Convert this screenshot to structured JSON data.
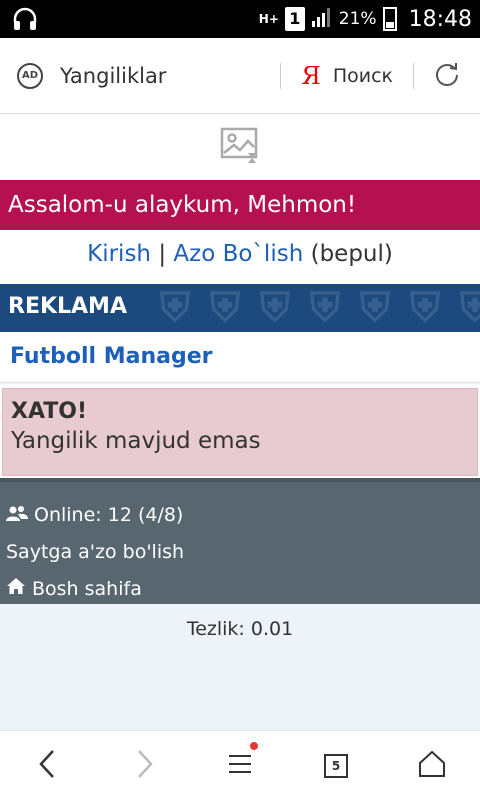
{
  "status_bar": {
    "network": "H+",
    "sim": "1",
    "battery": "21%",
    "time": "18:48",
    "icons": [
      "headphones-icon",
      "signal-icon",
      "battery-icon"
    ]
  },
  "toolbar": {
    "ad_badge": "AD",
    "title": "Yangiliklar",
    "search_logo": "Я",
    "search_label": "Поиск"
  },
  "page": {
    "greeting": "Assalom-u alaykum, Mehmon!",
    "auth": {
      "login": "Kirish",
      "separator": "|",
      "register": "Azo Bo`lish",
      "register_note": "(bepul)"
    },
    "ad_bar": "REKLAMA",
    "ad_link": "Futboll Manager",
    "error": {
      "title": "XATO!",
      "message": "Yangilik mavjud emas"
    },
    "info": {
      "online": "Online: 12 (4/8)",
      "join": "Saytga a'zo bo'lish",
      "home": "Bosh sahifa"
    },
    "speed": "Tezlik: 0.01"
  },
  "bottom_nav": {
    "tabs_count": "5"
  },
  "colors": {
    "greeting_bg": "#b5104f",
    "ad_bar_bg": "#1c4a7e",
    "link": "#1e5fb8",
    "error_bg": "#e8cbd0",
    "info_bg": "#58666f",
    "footer_bg": "#eef3fa"
  }
}
